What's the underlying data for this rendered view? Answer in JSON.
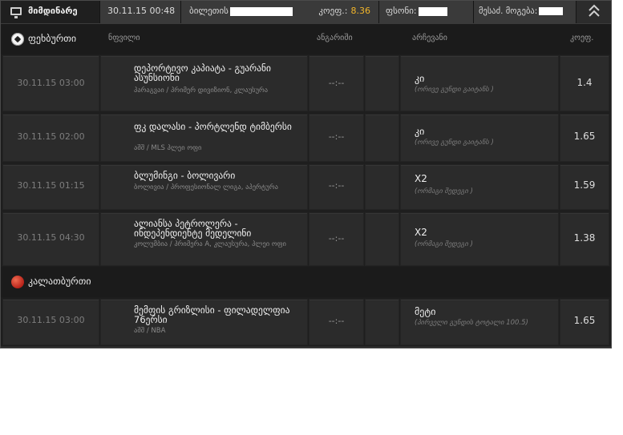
{
  "topbar": {
    "current_label": "მიმდინარე",
    "datetime": "30.11.15 00:48",
    "ticket_label": "ბილეთის",
    "coef_label": "კოეფ.:",
    "coef_value": "8.36",
    "stake_label": "ფსონი:",
    "win_label": "მესაძ. მოგება:",
    "collapse_icon": "double-chevron-up-icon"
  },
  "columns": {
    "event": "ნფვილი",
    "score": "ანგარიში",
    "pick": "არჩევანი",
    "coef": "კოეფ."
  },
  "sections": [
    {
      "name": "ფეხბურთი",
      "icon": "soccer-ball-icon",
      "rows": [
        {
          "time": "30.11.15 03:00",
          "event": "დეპორტივო კაპიატა - გუარანი ასუნსიონი",
          "league": "პარაგვაი / პრიმერ დივიზიონ, კლაუსურა",
          "score": "--:--",
          "pick": "კი",
          "pick_sub": "(ორივე გუნდი გაიტანს )",
          "odd": "1.4"
        },
        {
          "time": "30.11.15 02:00",
          "event": "ფკ დალასი - პორტლენდ ტიმბერსი",
          "league": "აშშ / MLS პლეი ოფი",
          "score": "--:--",
          "pick": "კი",
          "pick_sub": "(ორივე გუნდი გაიტანს )",
          "odd": "1.65"
        },
        {
          "time": "30.11.15 01:15",
          "event": "ბლუმინგი - ბოლივარი",
          "league": "ბოლივია / პროფესიონალ ლიგა, აპერტურა",
          "score": "--:--",
          "pick": "X2",
          "pick_sub": "(ორმაგი შედეგი )",
          "odd": "1.59"
        },
        {
          "time": "30.11.15 04:30",
          "event": "ალიანსა პეტროლერა - ინდეპენდიენტე მედელინი",
          "league": "კოლუმბია / პრიმერა A, კლაუსურა, პლეი ოფი",
          "score": "--:--",
          "pick": "X2",
          "pick_sub": "(ორმაგი შედეგი )",
          "odd": "1.38"
        }
      ]
    },
    {
      "name": "კალათბურთი",
      "icon": "basketball-icon",
      "rows": [
        {
          "time": "30.11.15 03:00",
          "event": "მემფის გრიზლისი - ფილადელფია 76ერსი",
          "league": "აშშ / NBA",
          "score": "--:--",
          "pick": "მეტი",
          "pick_sub": "(პირველი გუნდის ტოტალი 100.5)",
          "odd": "1.65"
        }
      ]
    }
  ]
}
